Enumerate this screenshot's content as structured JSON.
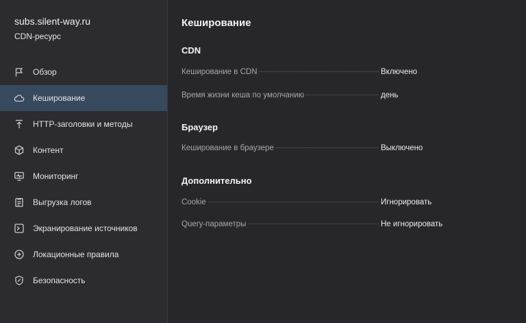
{
  "resource": {
    "name": "subs.silent-way.ru",
    "type": "CDN-ресурс"
  },
  "sidebar": {
    "items": [
      {
        "label": "Обзор",
        "icon": "flag-icon",
        "active": false
      },
      {
        "label": "Кеширование",
        "icon": "cloud-icon",
        "active": true
      },
      {
        "label": "HTTP-заголовки и методы",
        "icon": "upload-arrow-icon",
        "active": false
      },
      {
        "label": "Контент",
        "icon": "cube-icon",
        "active": false
      },
      {
        "label": "Мониторинг",
        "icon": "monitor-icon",
        "active": false
      },
      {
        "label": "Выгрузка логов",
        "icon": "clipboard-list-icon",
        "active": false
      },
      {
        "label": "Экранирование источников",
        "icon": "shield-screen-icon",
        "active": false
      },
      {
        "label": "Локационные правила",
        "icon": "location-plus-icon",
        "active": false
      },
      {
        "label": "Безопасность",
        "icon": "security-shield-icon",
        "active": false
      }
    ]
  },
  "main": {
    "title": "Кеширование",
    "sections": [
      {
        "title": "CDN",
        "rows": [
          {
            "label": "Кеширование в CDN",
            "value": "Включено"
          },
          {
            "label": "Время жизни кеша по умолчанию",
            "value": "день"
          }
        ]
      },
      {
        "title": "Браузер",
        "rows": [
          {
            "label": "Кеширование в браузере",
            "value": "Выключено"
          }
        ]
      },
      {
        "title": "Дополнительно",
        "rows": [
          {
            "label": "Cookie",
            "value": "Игнорировать"
          },
          {
            "label": "Query-параметры",
            "value": "Не игнорировать"
          }
        ]
      }
    ]
  },
  "colors": {
    "background": "#27272b",
    "sidebar": "#2b2b30",
    "active_item": "#37495c",
    "muted_text": "#a6a6ad"
  }
}
